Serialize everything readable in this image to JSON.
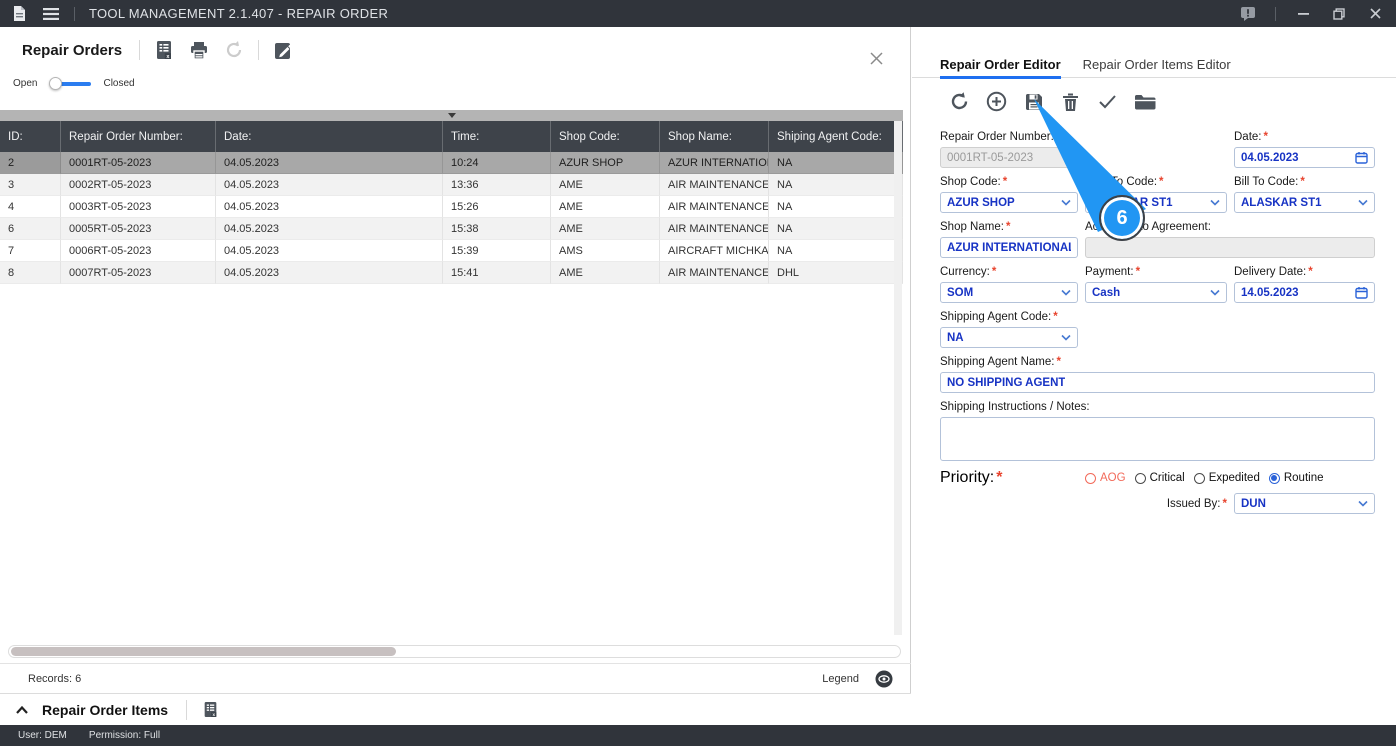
{
  "title_bar": {
    "title": "TOOL MANAGEMENT 2.1.407 - REPAIR ORDER",
    "icons": [
      "document-icon",
      "menu-icon",
      "feedback-icon",
      "minimize-icon",
      "restore-icon",
      "close-icon"
    ]
  },
  "left_panel": {
    "title": "Repair Orders",
    "toolbar_icons": [
      "export-excel-icon",
      "print-icon",
      "refresh-icon",
      "edit-icon"
    ],
    "toggle": {
      "open_label": "Open",
      "closed_label": "Closed",
      "state": "Open"
    },
    "table": {
      "columns": [
        "ID:",
        "Repair Order Number:",
        "Date:",
        "Time:",
        "Shop Code:",
        "Shop Name:",
        "Shiping Agent Code:"
      ],
      "rows": [
        [
          "2",
          "0001RT-05-2023",
          "04.05.2023",
          "10:24",
          "AZUR SHOP",
          "AZUR INTERNATION...",
          "NA"
        ],
        [
          "3",
          "0002RT-05-2023",
          "04.05.2023",
          "13:36",
          "AME",
          "AIR MAINTENANCE E...",
          "NA"
        ],
        [
          "4",
          "0003RT-05-2023",
          "04.05.2023",
          "15:26",
          "AME",
          "AIR MAINTENANCE E...",
          "NA"
        ],
        [
          "6",
          "0005RT-05-2023",
          "04.05.2023",
          "15:38",
          "AME",
          "AIR MAINTENANCE E...",
          "NA"
        ],
        [
          "7",
          "0006RT-05-2023",
          "04.05.2023",
          "15:39",
          "AMS",
          "AIRCRAFT MICHKAS...",
          "NA"
        ],
        [
          "8",
          "0007RT-05-2023",
          "04.05.2023",
          "15:41",
          "AME",
          "AIR MAINTENANCE E...",
          "DHL"
        ]
      ],
      "selected_row_index": 0
    },
    "records_label": "Records: 6",
    "legend_label": "Legend",
    "legend_icon": "legend-eye-icon",
    "items_section": {
      "title": "Repair Order Items",
      "icons": [
        "collapse-chevron-icon",
        "export-excel-icon"
      ]
    }
  },
  "right_panel": {
    "tabs": [
      {
        "label": "Repair Order Editor",
        "active": true
      },
      {
        "label": "Repair Order Items Editor",
        "active": false
      }
    ],
    "toolbar_icons": [
      "refresh-icon",
      "add-icon",
      "save-icon",
      "delete-icon",
      "confirm-icon",
      "folder-icon"
    ],
    "form": {
      "required_marker": "*",
      "repair_order_number": {
        "label": "Repair Order Number:",
        "value": "0001RT-05-2023",
        "disabled": true
      },
      "date": {
        "label": "Date:",
        "value": "04.05.2023"
      },
      "shop_code": {
        "label": "Shop Code:",
        "value": "AZUR SHOP"
      },
      "ship_to_code": {
        "label": "Ship To Code:",
        "value": "ALASKAR ST1"
      },
      "bill_to_code": {
        "label": "Bill To Code:",
        "value": "ALASKAR ST1"
      },
      "shop_name": {
        "label": "Shop Name:",
        "value": "AZUR INTERNATIONAL COM"
      },
      "according_to_agreement": {
        "label": "According to Agreement:",
        "value": "",
        "disabled": true
      },
      "currency": {
        "label": "Currency:",
        "value": "SOM"
      },
      "payment": {
        "label": "Payment:",
        "value": "Cash"
      },
      "delivery_date": {
        "label": "Delivery Date:",
        "value": "14.05.2023"
      },
      "shipping_agent_code": {
        "label": "Shipping Agent Code:",
        "value": "NA"
      },
      "shipping_agent_name": {
        "label": "Shipping Agent Name:",
        "value": "NO SHIPPING AGENT"
      },
      "shipping_notes": {
        "label": "Shipping Instructions / Notes:",
        "value": ""
      },
      "priority": {
        "label": "Priority:",
        "options": [
          "AOG",
          "Critical",
          "Expedited",
          "Routine"
        ],
        "selected": "Routine"
      },
      "issued_by": {
        "label": "Issued By:",
        "value": "DUN"
      }
    },
    "callout": {
      "step_number": "6",
      "color": "#2196f3"
    }
  },
  "status_bar": {
    "user": "User: DEM",
    "permission": "Permission: Full"
  },
  "colors": {
    "titlebar": "#30343b",
    "table_header": "#3e434a",
    "selected_row": "#a8a8a8",
    "accent_blue": "#1e6ff0",
    "value_blue": "#1733c4",
    "required_red": "#e8442e",
    "callout_blue": "#2196f3"
  }
}
